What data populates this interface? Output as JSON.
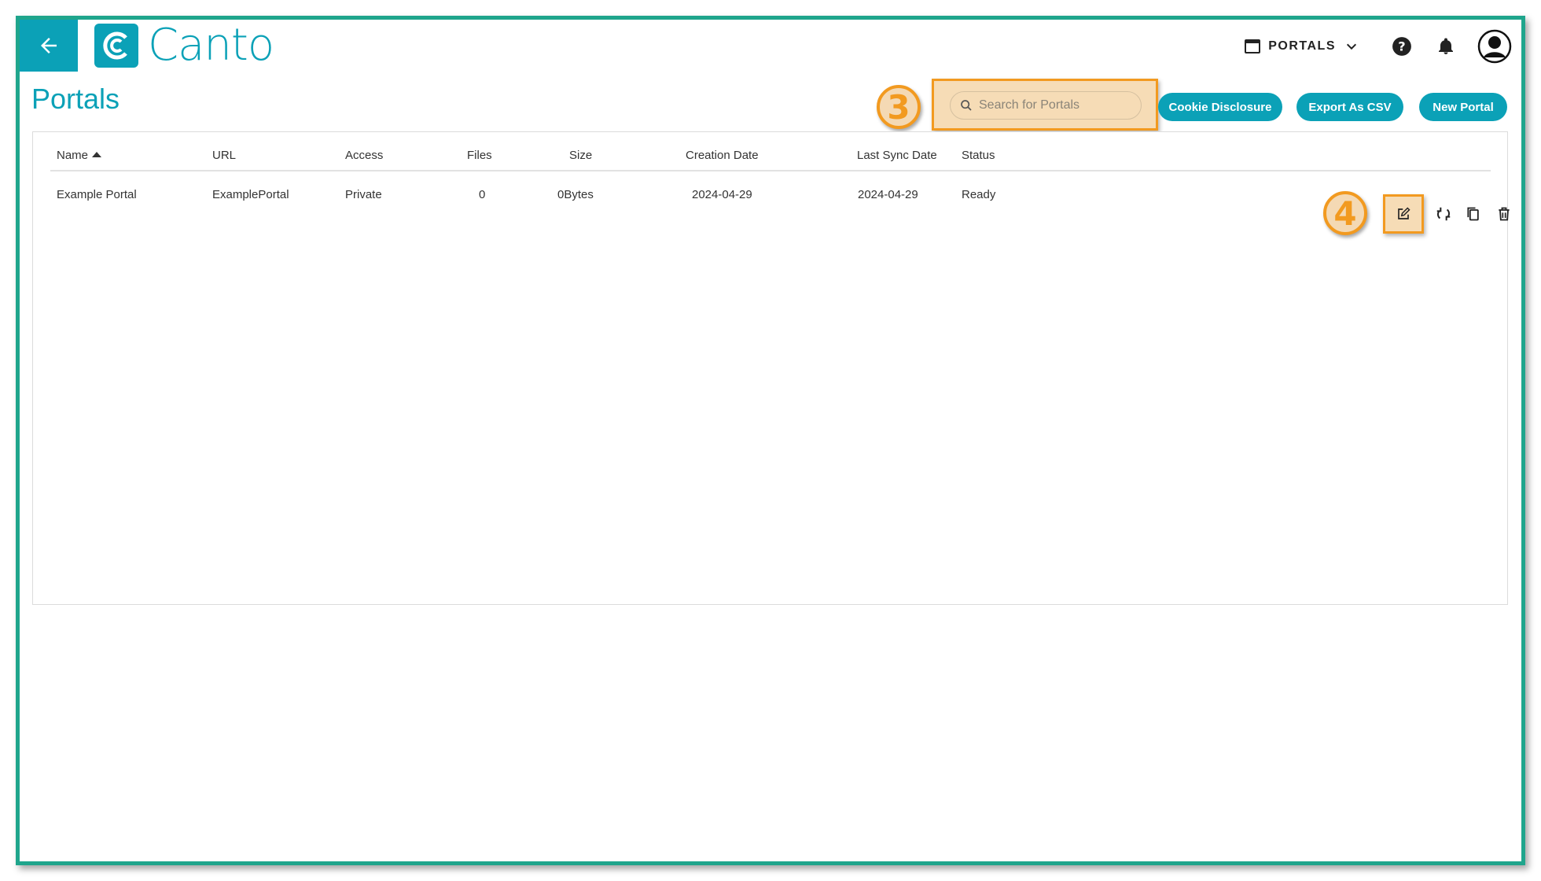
{
  "header": {
    "back_icon": "arrow-left-icon",
    "logo_text": "Canto",
    "switch_label": "PORTALS",
    "help_icon": "help-icon",
    "bell_icon": "bell-icon",
    "avatar_icon": "account-circle-icon"
  },
  "page": {
    "title": "Portals"
  },
  "toolbar": {
    "search_placeholder": "Search for Portals",
    "cookie_label": "Cookie Disclosure",
    "export_label": "Export As CSV",
    "new_label": "New Portal"
  },
  "callouts": {
    "search": "3",
    "edit": "4"
  },
  "table": {
    "columns": [
      "Name",
      "URL",
      "Access",
      "Files",
      "Size",
      "Creation Date",
      "Last Sync Date",
      "Status"
    ],
    "rows": [
      {
        "name": "Example Portal",
        "url": "ExamplePortal",
        "access": "Private",
        "files": "0",
        "size": "0Bytes",
        "creation_date": "2024-04-29",
        "last_sync_date": "2024-04-29",
        "status": "Ready"
      }
    ]
  },
  "colors": {
    "accent": "#0ba1b7",
    "frame": "#1fa58c",
    "highlight": "#f29a20"
  }
}
